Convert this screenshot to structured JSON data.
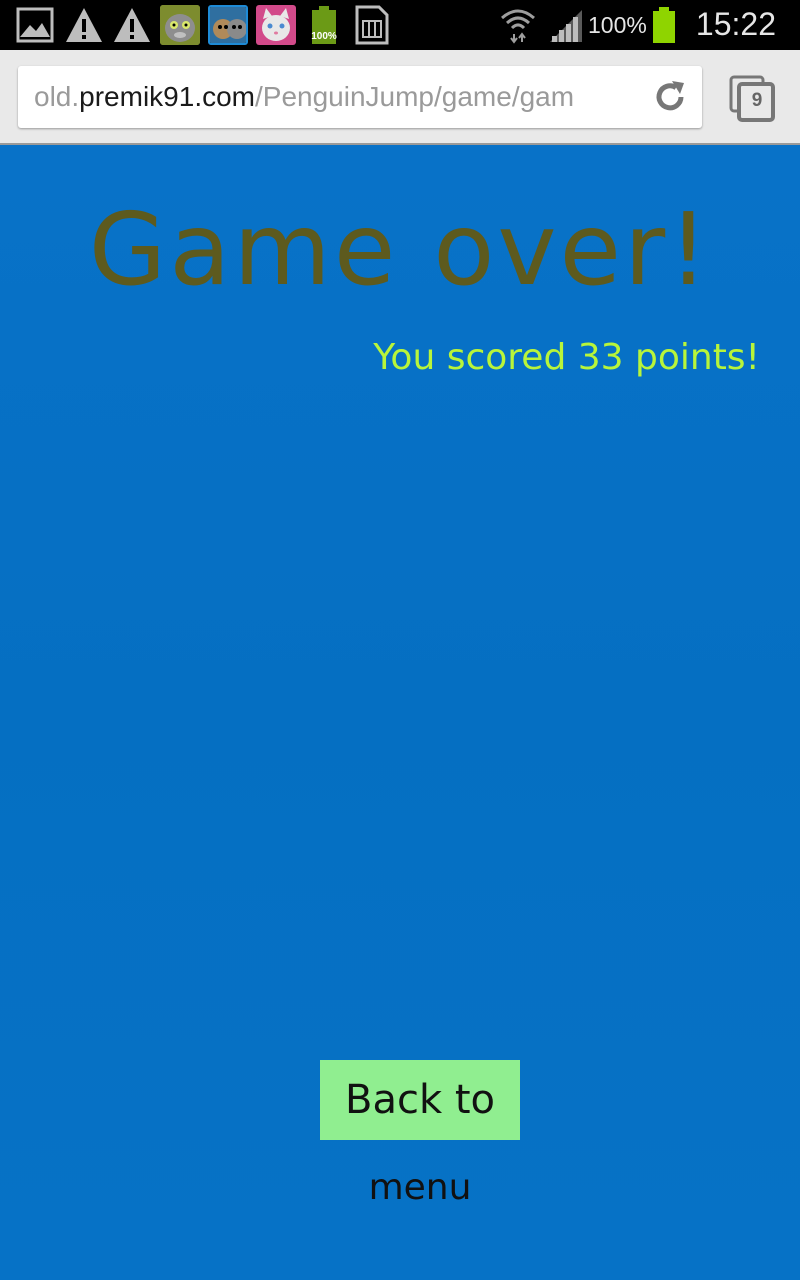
{
  "status_bar": {
    "icons": [
      "gallery-icon",
      "warning-icon",
      "warning-icon",
      "talking-tom-app-icon",
      "talking-friends-app-icon",
      "talking-angela-app-icon",
      "battery-full-icon",
      "sim-card-icon",
      "wifi-icon",
      "signal-icon",
      "battery-icon"
    ],
    "battery_notification_label": "100%",
    "battery_percent": "100%",
    "clock": "15:22"
  },
  "browser": {
    "url_prefix": "old.",
    "url_host": "premik91.com",
    "url_path": "/PenguinJump/game/gam",
    "tab_count": "9"
  },
  "game": {
    "title": "Game over!",
    "score_text": "You scored 33 points!",
    "back_button_line1": "Back to",
    "back_button_line2": "menu"
  },
  "colors": {
    "background": "#0070c0",
    "title": "#5d5a1e",
    "score": "#b8f53a",
    "button": "#90ee90",
    "battery_green": "#8fd400"
  }
}
